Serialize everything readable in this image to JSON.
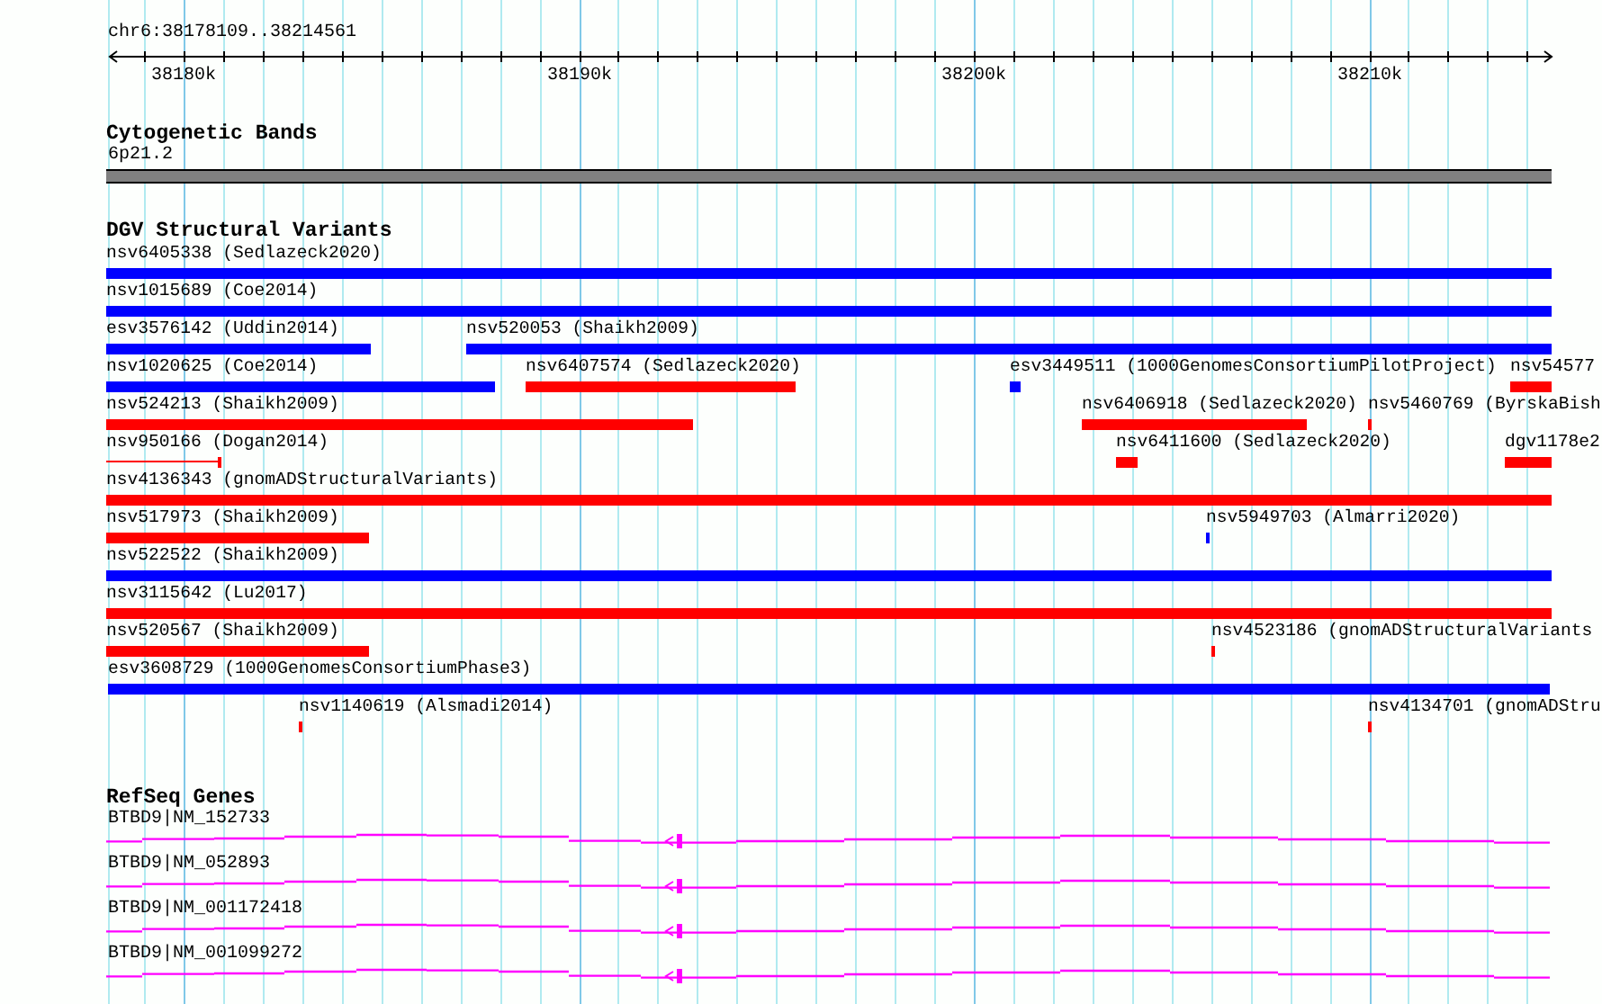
{
  "ruler": {
    "region": "chr6:38178109..38214561",
    "ticks": [
      "38180k",
      "38190k",
      "38200k",
      "38210k"
    ]
  },
  "tracks": [
    {
      "title": "Cytogenetic Bands",
      "kind": "bands",
      "bands": [
        {
          "label": "6p21.2"
        }
      ]
    },
    {
      "title": "DGV Structural Variants",
      "kind": "variants",
      "rows": [
        {
          "features": [
            {
              "label": "nsv6405338 (Sedlazeck2020)",
              "color": "#0000ff",
              "kind": "bar"
            }
          ]
        },
        {
          "features": [
            {
              "label": "nsv1015689 (Coe2014)",
              "color": "#0000ff",
              "kind": "bar"
            }
          ]
        },
        {
          "features": [
            {
              "label": "esv3576142 (Uddin2014)",
              "color": "#0000ff",
              "kind": "bar"
            },
            {
              "label": "nsv520053 (Shaikh2009)",
              "color": "#0000ff",
              "kind": "bar"
            }
          ]
        },
        {
          "features": [
            {
              "label": "nsv1020625 (Coe2014)",
              "color": "#0000ff",
              "kind": "bar"
            },
            {
              "label": "nsv6407574 (Sedlazeck2020)",
              "color": "#ff0000",
              "kind": "bar"
            },
            {
              "label": "esv3449511 (1000GenomesConsortiumPilotProject)",
              "color": "#0000ff",
              "kind": "bar"
            },
            {
              "label": "nsv54577",
              "color": "#ff0000",
              "kind": "bar"
            }
          ]
        },
        {
          "features": [
            {
              "label": "nsv524213 (Shaikh2009)",
              "color": "#ff0000",
              "kind": "bar"
            },
            {
              "label": "nsv6406918 (Sedlazeck2020)",
              "color": "#ff0000",
              "kind": "bar"
            },
            {
              "label": "nsv5460769 (ByrskaBish",
              "color": "#ff0000",
              "kind": "bar"
            }
          ]
        },
        {
          "features": [
            {
              "label": "nsv950166 (Dogan2014)",
              "color": "#ff0000",
              "kind": "line"
            },
            {
              "label": "nsv6411600 (Sedlazeck2020)",
              "color": "#ff0000",
              "kind": "bar"
            },
            {
              "label": "dgv1178e2",
              "color": "#ff0000",
              "kind": "bar"
            }
          ]
        },
        {
          "features": [
            {
              "label": "nsv4136343 (gnomADStructuralVariants)",
              "color": "#ff0000",
              "kind": "bar"
            }
          ]
        },
        {
          "features": [
            {
              "label": "nsv517973 (Shaikh2009)",
              "color": "#ff0000",
              "kind": "bar"
            },
            {
              "label": "nsv5949703 (Almarri2020)",
              "color": "#0000ff",
              "kind": "bar"
            }
          ]
        },
        {
          "features": [
            {
              "label": "nsv522522 (Shaikh2009)",
              "color": "#0000ff",
              "kind": "bar"
            }
          ]
        },
        {
          "features": [
            {
              "label": "nsv3115642 (Lu2017)",
              "color": "#ff0000",
              "kind": "bar"
            }
          ]
        },
        {
          "features": [
            {
              "label": "nsv520567 (Shaikh2009)",
              "color": "#ff0000",
              "kind": "bar"
            },
            {
              "label": "nsv4523186 (gnomADStructuralVariants",
              "color": "#ff0000",
              "kind": "bar"
            }
          ]
        },
        {
          "features": [
            {
              "label": "esv3608729 (1000GenomesConsortiumPhase3)",
              "color": "#0000ff",
              "kind": "bar"
            }
          ]
        },
        {
          "features": [
            {
              "label": "nsv1140619 (Alsmadi2014)",
              "color": "#ff0000",
              "kind": "bar"
            },
            {
              "label": "nsv4134701 (gnomADStru",
              "color": "#ff0000",
              "kind": "bar"
            }
          ]
        }
      ]
    },
    {
      "title": "RefSeq Genes",
      "kind": "genes",
      "genes": [
        {
          "label": "BTBD9|NM_152733"
        },
        {
          "label": "BTBD9|NM_052893"
        },
        {
          "label": "BTBD9|NM_001172418"
        },
        {
          "label": "BTBD9|NM_001099272"
        }
      ]
    }
  ]
}
